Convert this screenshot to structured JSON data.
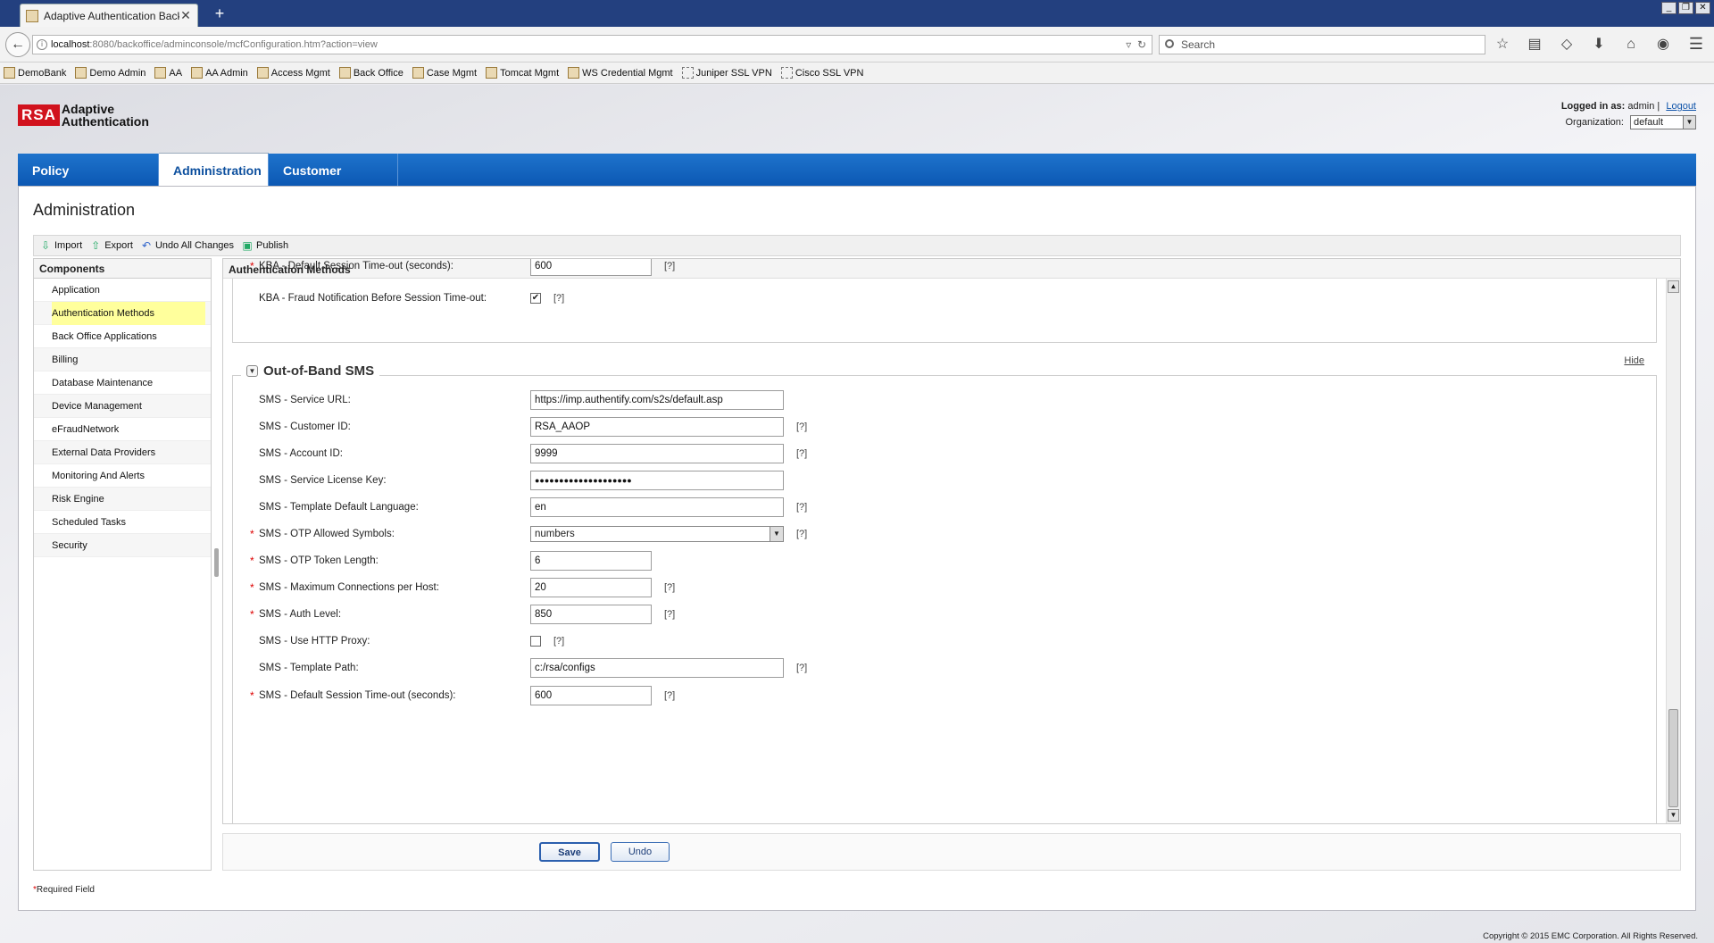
{
  "browser": {
    "tab_title": "Adaptive Authentication Back...",
    "tab_close": "✕",
    "new_tab": "+",
    "url_host": "localhost",
    "url_rest": ":8080/backoffice/adminconsole/mcfConfiguration.htm?action=view",
    "search_placeholder": "Search",
    "bookmarks": [
      "DemoBank",
      "Demo Admin",
      "AA",
      "AA Admin",
      "Access Mgmt",
      "Back Office",
      "Case Mgmt",
      "Tomcat Mgmt",
      "WS Credential Mgmt",
      "Juniper SSL VPN",
      "Cisco SSL VPN"
    ]
  },
  "header": {
    "logo_mark": "RSA",
    "logo_line1": "Adaptive",
    "logo_line2": "Authentication",
    "logged_in_label": "Logged in as:",
    "user": "admin",
    "logout": "Logout",
    "org_label": "Organization:",
    "org_value": "default"
  },
  "nav": {
    "tabs": [
      "Policy Management",
      "Administration",
      "Customer Service"
    ],
    "active": "Administration"
  },
  "page_title": "Administration",
  "actions": [
    "Import",
    "Export",
    "Undo All Changes",
    "Publish"
  ],
  "sidebar": {
    "title": "Components",
    "items": [
      "Application",
      "Authentication Methods",
      "Back Office Applications",
      "Billing",
      "Database Maintenance",
      "Device Management",
      "eFraudNetwork",
      "External Data Providers",
      "Monitoring And Alerts",
      "Risk Engine",
      "Scheduled Tasks",
      "Security"
    ],
    "selected": "Authentication Methods"
  },
  "content": {
    "title": "Authentication Methods",
    "kba": {
      "timeout_label": "KBA - Default Session Time-out (seconds):",
      "timeout_value": "600",
      "fraud_label": "KBA - Fraud Notification Before Session Time-out:",
      "fraud_checked": "✔"
    },
    "help": "[?]",
    "sms_section": "Out-of-Band SMS",
    "hide_label": "Hide",
    "sms_fields": {
      "service_url": {
        "label": "SMS - Service URL:",
        "value": "https://imp.authentify.com/s2s/default.asp"
      },
      "customer_id": {
        "label": "SMS - Customer ID:",
        "value": "RSA_AAOP"
      },
      "account_id": {
        "label": "SMS - Account ID:",
        "value": "9999"
      },
      "license_key": {
        "label": "SMS - Service License Key:",
        "value": "●●●●●●●●●●●●●●●●●●●●"
      },
      "template_lang": {
        "label": "SMS - Template Default Language:",
        "value": "en"
      },
      "otp_symbols": {
        "label": "SMS - OTP Allowed Symbols:",
        "value": "numbers"
      },
      "otp_length": {
        "label": "SMS - OTP Token Length:",
        "value": "6"
      },
      "max_connections": {
        "label": "SMS - Maximum Connections per Host:",
        "value": "20"
      },
      "auth_level": {
        "label": "SMS - Auth Level:",
        "value": "850"
      },
      "http_proxy": {
        "label": "SMS - Use HTTP Proxy:"
      },
      "template_path": {
        "label": "SMS - Template Path:",
        "value": "c:/rsa/configs"
      },
      "session_timeout": {
        "label": "SMS - Default Session Time-out (seconds):",
        "value": "600"
      }
    }
  },
  "buttons": {
    "save": "Save",
    "undo": "Undo"
  },
  "required_note": "Required Field",
  "copyright": "Copyright © 2015 EMC Corporation. All Rights Reserved."
}
